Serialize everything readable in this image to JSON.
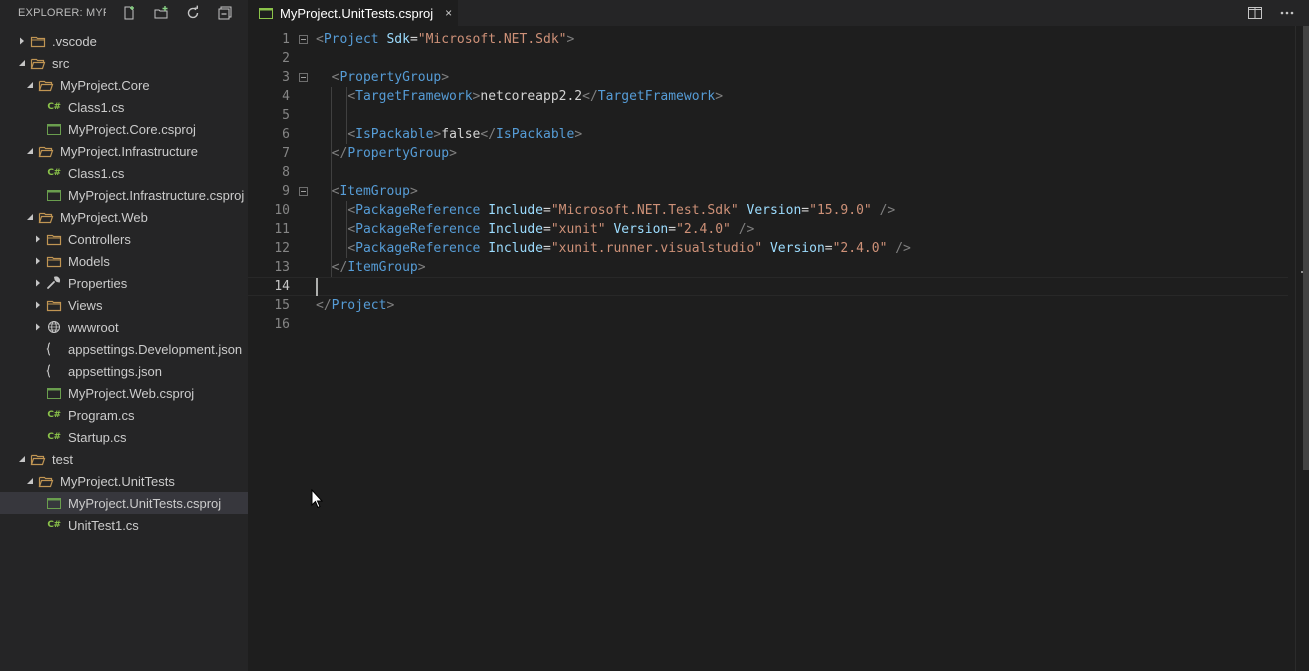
{
  "sidebar": {
    "title": "EXPLORER: MYP...",
    "actions": [
      {
        "name": "new-file-icon"
      },
      {
        "name": "new-folder-icon"
      },
      {
        "name": "refresh-icon"
      },
      {
        "name": "collapse-all-icon"
      }
    ],
    "tree": [
      {
        "label": ".vscode",
        "type": "folder",
        "expanded": false,
        "depth": 0
      },
      {
        "label": "src",
        "type": "folder",
        "expanded": true,
        "depth": 0
      },
      {
        "label": "MyProject.Core",
        "type": "folder",
        "expanded": true,
        "depth": 1
      },
      {
        "label": "Class1.cs",
        "type": "cs",
        "depth": 2
      },
      {
        "label": "MyProject.Core.csproj",
        "type": "csproj",
        "depth": 2
      },
      {
        "label": "MyProject.Infrastructure",
        "type": "folder",
        "expanded": true,
        "depth": 1
      },
      {
        "label": "Class1.cs",
        "type": "cs",
        "depth": 2
      },
      {
        "label": "MyProject.Infrastructure.csproj",
        "type": "csproj",
        "depth": 2
      },
      {
        "label": "MyProject.Web",
        "type": "folder",
        "expanded": true,
        "depth": 1
      },
      {
        "label": "Controllers",
        "type": "folder",
        "expanded": false,
        "depth": 2
      },
      {
        "label": "Models",
        "type": "folder",
        "expanded": false,
        "depth": 2
      },
      {
        "label": "Properties",
        "type": "wrench",
        "expanded": false,
        "depth": 2
      },
      {
        "label": "Views",
        "type": "folder",
        "expanded": false,
        "depth": 2
      },
      {
        "label": "wwwroot",
        "type": "globe",
        "expanded": false,
        "depth": 2
      },
      {
        "label": "appsettings.Development.json",
        "type": "json",
        "depth": 2
      },
      {
        "label": "appsettings.json",
        "type": "json",
        "depth": 2
      },
      {
        "label": "MyProject.Web.csproj",
        "type": "csproj",
        "depth": 2
      },
      {
        "label": "Program.cs",
        "type": "cs",
        "depth": 2
      },
      {
        "label": "Startup.cs",
        "type": "cs",
        "depth": 2
      },
      {
        "label": "test",
        "type": "folder",
        "expanded": true,
        "depth": 0
      },
      {
        "label": "MyProject.UnitTests",
        "type": "folder",
        "expanded": true,
        "depth": 1
      },
      {
        "label": "MyProject.UnitTests.csproj",
        "type": "csproj",
        "depth": 2,
        "selected": true
      },
      {
        "label": "UnitTest1.cs",
        "type": "cs",
        "depth": 2
      }
    ]
  },
  "tab": {
    "label": "MyProject.UnitTests.csproj",
    "close": "×"
  },
  "editor": {
    "current_line": 14,
    "lines": [
      {
        "n": "1",
        "fold": true,
        "tokens": [
          [
            "b",
            "<"
          ],
          [
            "t",
            "Project"
          ],
          [
            "p",
            " "
          ],
          [
            "a",
            "Sdk"
          ],
          [
            "p",
            "="
          ],
          [
            "s",
            "\"Microsoft.NET.Sdk\""
          ],
          [
            "b",
            ">"
          ]
        ]
      },
      {
        "n": "2",
        "tokens": []
      },
      {
        "n": "3",
        "fold": true,
        "tokens": [
          [
            "p",
            "  "
          ],
          [
            "b",
            "<"
          ],
          [
            "t",
            "PropertyGroup"
          ],
          [
            "b",
            ">"
          ]
        ]
      },
      {
        "n": "4",
        "tokens": [
          [
            "p",
            "    "
          ],
          [
            "b",
            "<"
          ],
          [
            "t",
            "TargetFramework"
          ],
          [
            "b",
            ">"
          ],
          [
            "p",
            "netcoreapp2.2"
          ],
          [
            "b",
            "</"
          ],
          [
            "t",
            "TargetFramework"
          ],
          [
            "b",
            ">"
          ]
        ]
      },
      {
        "n": "5",
        "tokens": []
      },
      {
        "n": "6",
        "tokens": [
          [
            "p",
            "    "
          ],
          [
            "b",
            "<"
          ],
          [
            "t",
            "IsPackable"
          ],
          [
            "b",
            ">"
          ],
          [
            "p",
            "false"
          ],
          [
            "b",
            "</"
          ],
          [
            "t",
            "IsPackable"
          ],
          [
            "b",
            ">"
          ]
        ]
      },
      {
        "n": "7",
        "tokens": [
          [
            "p",
            "  "
          ],
          [
            "b",
            "</"
          ],
          [
            "t",
            "PropertyGroup"
          ],
          [
            "b",
            ">"
          ]
        ]
      },
      {
        "n": "8",
        "tokens": []
      },
      {
        "n": "9",
        "fold": true,
        "tokens": [
          [
            "p",
            "  "
          ],
          [
            "b",
            "<"
          ],
          [
            "t",
            "ItemGroup"
          ],
          [
            "b",
            ">"
          ]
        ]
      },
      {
        "n": "10",
        "tokens": [
          [
            "p",
            "    "
          ],
          [
            "b",
            "<"
          ],
          [
            "t",
            "PackageReference"
          ],
          [
            "p",
            " "
          ],
          [
            "a",
            "Include"
          ],
          [
            "p",
            "="
          ],
          [
            "s",
            "\"Microsoft.NET.Test.Sdk\""
          ],
          [
            "p",
            " "
          ],
          [
            "a",
            "Version"
          ],
          [
            "p",
            "="
          ],
          [
            "s",
            "\"15.9.0\""
          ],
          [
            "p",
            " "
          ],
          [
            "b",
            "/>"
          ]
        ]
      },
      {
        "n": "11",
        "tokens": [
          [
            "p",
            "    "
          ],
          [
            "b",
            "<"
          ],
          [
            "t",
            "PackageReference"
          ],
          [
            "p",
            " "
          ],
          [
            "a",
            "Include"
          ],
          [
            "p",
            "="
          ],
          [
            "s",
            "\"xunit\""
          ],
          [
            "p",
            " "
          ],
          [
            "a",
            "Version"
          ],
          [
            "p",
            "="
          ],
          [
            "s",
            "\"2.4.0\""
          ],
          [
            "p",
            " "
          ],
          [
            "b",
            "/>"
          ]
        ]
      },
      {
        "n": "12",
        "tokens": [
          [
            "p",
            "    "
          ],
          [
            "b",
            "<"
          ],
          [
            "t",
            "PackageReference"
          ],
          [
            "p",
            " "
          ],
          [
            "a",
            "Include"
          ],
          [
            "p",
            "="
          ],
          [
            "s",
            "\"xunit.runner.visualstudio\""
          ],
          [
            "p",
            " "
          ],
          [
            "a",
            "Version"
          ],
          [
            "p",
            "="
          ],
          [
            "s",
            "\"2.4.0\""
          ],
          [
            "p",
            " "
          ],
          [
            "b",
            "/>"
          ]
        ]
      },
      {
        "n": "13",
        "tokens": [
          [
            "p",
            "  "
          ],
          [
            "b",
            "</"
          ],
          [
            "t",
            "ItemGroup"
          ],
          [
            "b",
            ">"
          ]
        ]
      },
      {
        "n": "14",
        "tokens": []
      },
      {
        "n": "15",
        "tokens": [
          [
            "b",
            "</"
          ],
          [
            "t",
            "Project"
          ],
          [
            "b",
            ">"
          ]
        ]
      },
      {
        "n": "16",
        "tokens": []
      }
    ]
  },
  "colors": {
    "folder": "#c09553",
    "csharp": "#8bc34a",
    "csproj": "#6a9e4e",
    "tag": "#569cd6",
    "attr": "#9cdcfe",
    "string": "#ce9178"
  }
}
